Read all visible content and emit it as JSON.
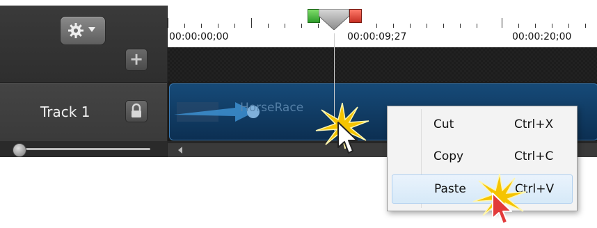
{
  "toolbar": {
    "gear_icon": "gear-icon",
    "dropdown_icon": "chevron-down-icon",
    "add_track_icon": "plus-icon"
  },
  "ruler": {
    "labels": [
      "00:00:00;00",
      "00:00:09;27",
      "00:00:20;00"
    ],
    "playhead_time": "00:00:09;27"
  },
  "track": {
    "name": "Track 1",
    "lock_icon": "lock-icon"
  },
  "clip": {
    "label": "HorseRace"
  },
  "context_menu": {
    "items": [
      {
        "label": "Cut",
        "shortcut": "Ctrl+X"
      },
      {
        "label": "Copy",
        "shortcut": "Ctrl+C"
      },
      {
        "label": "Paste",
        "shortcut": "Ctrl+V",
        "highlighted": true
      }
    ]
  },
  "colors": {
    "accent_green": "#2e9c2a",
    "accent_red": "#c62f23",
    "clip_blue": "#164a78",
    "highlight": "#d6e9f8",
    "burst_yellow": "#f5c400"
  }
}
